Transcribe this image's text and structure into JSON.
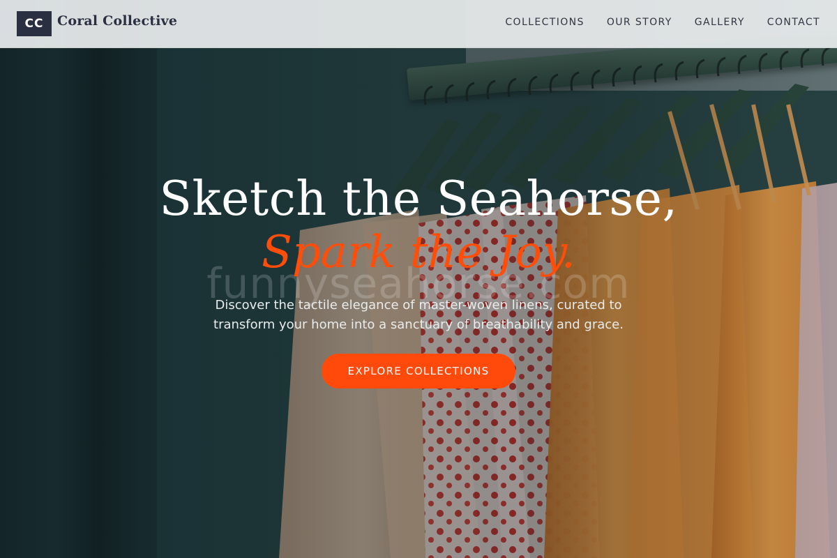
{
  "brand": {
    "badge": "CC",
    "name": "Coral Collective"
  },
  "nav": {
    "items": [
      {
        "label": "COLLECTIONS"
      },
      {
        "label": "OUR STORY"
      },
      {
        "label": "GALLERY"
      },
      {
        "label": "CONTACT"
      }
    ]
  },
  "hero": {
    "headline": "Sketch the Seahorse,",
    "subheadline": "Spark the Joy.",
    "watermark": "funnyseahorse.com",
    "description": "Discover the tactile elegance of master-woven linens, curated to transform your home into a sanctuary of breathability and grace.",
    "cta_label": "EXPLORE COLLECTIONS"
  },
  "colors": {
    "accent": "#ff4a0c",
    "brand_dark": "#2a2f42",
    "nav_bg": "#e8eced"
  }
}
